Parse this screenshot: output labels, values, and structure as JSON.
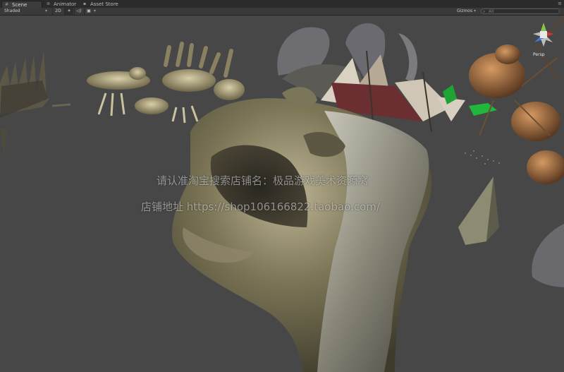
{
  "tabs": [
    {
      "label": "Scene",
      "icon": "scene-icon",
      "active": true
    },
    {
      "label": "Animator",
      "icon": "animator-icon",
      "active": false
    },
    {
      "label": "Asset Store",
      "icon": "asset-store-icon",
      "active": false
    }
  ],
  "tabs_menu_icon": "panel-menu-icon",
  "toolbar": {
    "shading_mode": "Shaded",
    "mode_2d": "2D",
    "lighting_icon": "sun-icon",
    "audio_icon": "speaker-icon",
    "effects_icon": "image-icon",
    "gizmos_label": "Gizmos",
    "search_placeholder": "All"
  },
  "viewport": {
    "gizmo_label": "Persp",
    "watermark_line1": "请认准淘宝搜索店铺名：极品游戏美术资源窝",
    "watermark_line2": "店铺地址 https://shop106166822.taobao.com/",
    "background_color": "#474747"
  },
  "gizmo_colors": {
    "x": "#d2342f",
    "y": "#8bc34a",
    "z": "#3b7de0"
  }
}
